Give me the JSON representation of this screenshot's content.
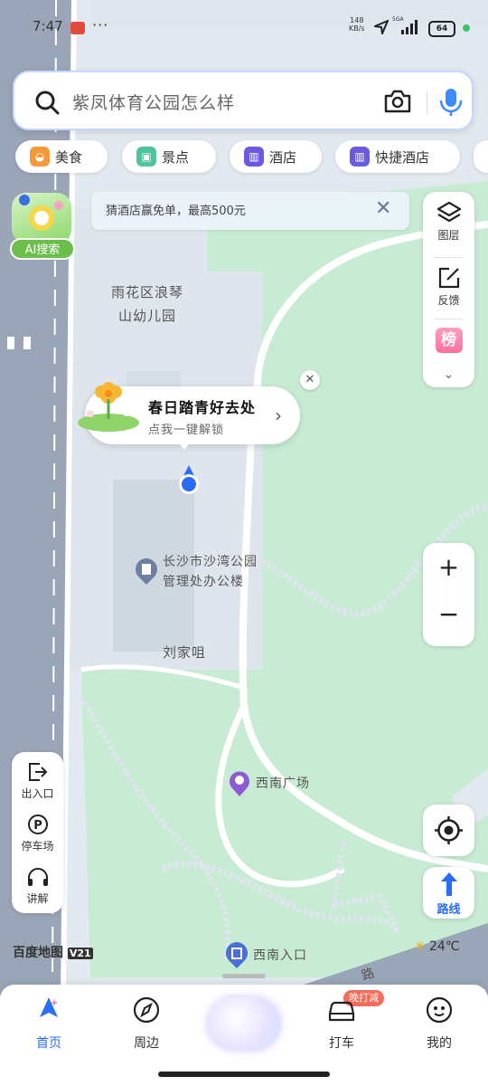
{
  "status_bar": {
    "time": "7:47",
    "net_speed": "148",
    "net_unit": "KB/s",
    "network": "5GA",
    "battery": "64"
  },
  "search": {
    "placeholder": "紫凤体育公园怎么样"
  },
  "chips": [
    {
      "label": "美食",
      "icon": "food-icon",
      "color": "#f59a3a"
    },
    {
      "label": "景点",
      "icon": "scenic-icon",
      "color": "#4fc39a"
    },
    {
      "label": "酒店",
      "icon": "hotel-icon",
      "color": "#6a5ae0"
    },
    {
      "label": "快捷酒店",
      "icon": "hotel-icon",
      "color": "#6a5ae0"
    }
  ],
  "ai_search": {
    "label": "AI搜索"
  },
  "promo_banner": {
    "text": "猜酒店赢免单，最高500元"
  },
  "right_panel": {
    "layers_label": "图层",
    "feedback_label": "反馈",
    "ranking_label": "榜"
  },
  "callout": {
    "title": "春日踏青好去处",
    "subtitle": "点我一键解锁"
  },
  "map_labels": {
    "kindergarten": "雨花区浪琴\n山幼儿园",
    "office": "长沙市沙湾公园\n管理处办公楼",
    "place": "刘家咀",
    "plaza": "西南广场",
    "entrance": "西南入口",
    "road": "路"
  },
  "left_panel": {
    "exit_label": "出入口",
    "parking_label": "停车场",
    "audio_label": "讲解"
  },
  "route": {
    "label": "路线"
  },
  "logo": {
    "text": "百度地图",
    "version": "V21"
  },
  "weather": {
    "temp": "24℃"
  },
  "bottom_nav": {
    "home": "首页",
    "nearby": "周边",
    "taxi": "打车",
    "taxi_badge": "晚打减",
    "mine": "我的"
  },
  "colors": {
    "accent": "#2a6df4",
    "park_green": "#c8ecd3",
    "road_gray": "#9aa6b8"
  }
}
